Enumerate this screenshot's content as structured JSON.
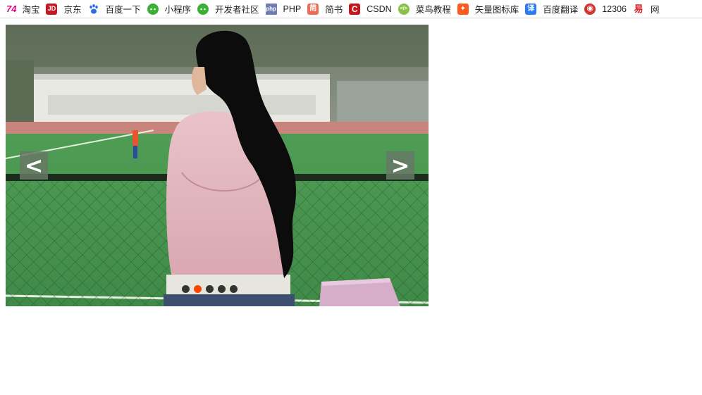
{
  "bookmarks": [
    {
      "label": "淘宝",
      "icon": "taobao-icon",
      "icon_text": "74",
      "color": "#e4007f"
    },
    {
      "label": "京东",
      "icon": "jd-icon",
      "icon_text": "JD",
      "color": "#c91623"
    },
    {
      "label": "百度一下",
      "icon": "baidu-paw-icon",
      "icon_text": "🐾",
      "color": "#2d6be4"
    },
    {
      "label": "小程序",
      "icon": "wechat-icon",
      "icon_text": "●●",
      "color": "#3cb034"
    },
    {
      "label": "开发者社区",
      "icon": "wechat-icon",
      "icon_text": "●●",
      "color": "#3cb034"
    },
    {
      "label": "PHP",
      "icon": "php-icon",
      "icon_text": "php",
      "color": "#6f7cb6"
    },
    {
      "label": "简书",
      "icon": "jianshu-icon",
      "icon_text": "简",
      "color": "#ea6f5a"
    },
    {
      "label": "CSDN",
      "icon": "csdn-icon",
      "icon_text": "C",
      "color": "#c8161d"
    },
    {
      "label": "菜鸟教程",
      "icon": "runoob-icon",
      "icon_text": "</>",
      "color": "#8bc34a"
    },
    {
      "label": "矢量图标库",
      "icon": "iconfont-icon",
      "icon_text": "✦",
      "color": "#ff5a1f"
    },
    {
      "label": "百度翻译",
      "icon": "translate-icon",
      "icon_text": "译",
      "color": "#2b7cf2"
    },
    {
      "label": "12306",
      "icon": "railway-icon",
      "icon_text": "◉",
      "color": "#d0342c"
    },
    {
      "label": "网",
      "icon": "yi-icon",
      "icon_text": "易",
      "color": "#d61f26"
    }
  ],
  "carousel": {
    "prev_label": "<",
    "next_label": ">",
    "slide_count": 5,
    "active_index": 1,
    "active_color": "#ff4400",
    "dot_color": "#333333"
  }
}
